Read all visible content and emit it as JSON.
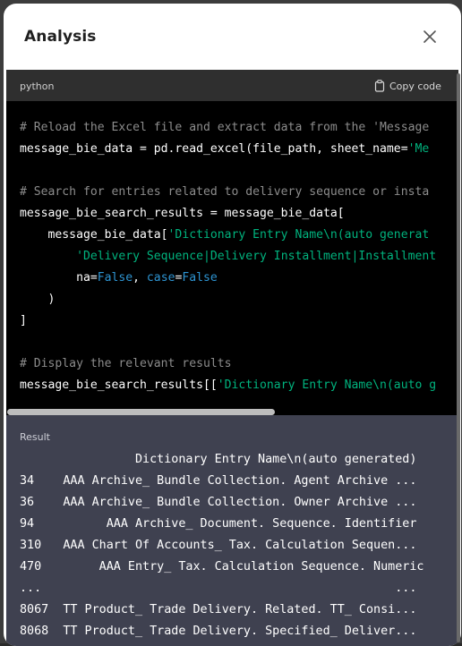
{
  "modal": {
    "title": "Analysis",
    "close_icon": "close-icon"
  },
  "code_block": {
    "language": "python",
    "copy_label": "Copy code",
    "copy_icon": "clipboard-icon",
    "lines": [
      [
        {
          "t": "# Reload the Excel file and extract data from the 'Message",
          "c": "comment"
        }
      ],
      [
        {
          "t": "message_bie_data = pd.read_excel(file_path, sheet_name=",
          "c": ""
        },
        {
          "t": "'Me",
          "c": "str"
        }
      ],
      [],
      [
        {
          "t": "# Search for entries related to delivery sequence or insta",
          "c": "comment"
        }
      ],
      [
        {
          "t": "message_bie_search_results = message_bie_data[",
          "c": ""
        }
      ],
      [
        {
          "t": "    message_bie_data[",
          "c": ""
        },
        {
          "t": "'Dictionary Entry Name\\n(auto generat",
          "c": "str"
        }
      ],
      [
        {
          "t": "        ",
          "c": ""
        },
        {
          "t": "'Delivery Sequence|Delivery Installment|Installment",
          "c": "str"
        }
      ],
      [
        {
          "t": "        na=",
          "c": ""
        },
        {
          "t": "False",
          "c": "kw"
        },
        {
          "t": ", ",
          "c": ""
        },
        {
          "t": "case",
          "c": "kw"
        },
        {
          "t": "=",
          "c": ""
        },
        {
          "t": "False",
          "c": "kw"
        }
      ],
      [
        {
          "t": "    )",
          "c": ""
        }
      ],
      [
        {
          "t": "]",
          "c": ""
        }
      ],
      [],
      [
        {
          "t": "# Display the relevant results",
          "c": "comment"
        }
      ],
      [
        {
          "t": "message_bie_search_results[[",
          "c": ""
        },
        {
          "t": "'Dictionary Entry Name\\n(auto g",
          "c": "str"
        }
      ]
    ]
  },
  "result": {
    "label": "Result",
    "lines": [
      "                Dictionary Entry Name\\n(auto generated)",
      "34    AAA Archive_ Bundle Collection. Agent Archive ...",
      "36    AAA Archive_ Bundle Collection. Owner Archive ...",
      "94          AAA Archive_ Document. Sequence. Identifier",
      "310   AAA Chart Of Accounts_ Tax. Calculation Sequen...",
      "470        AAA Entry_ Tax. Calculation Sequence. Numeric",
      "...                                                 ...",
      "8067  TT Product_ Trade Delivery. Related. TT_ Consi...",
      "8068  TT Product_ Trade Delivery. Specified_ Deliver..."
    ]
  },
  "colors": {
    "comment": "#8c8c8c",
    "string": "#00b37e",
    "keyword": "#2e95d3",
    "result_bg": "#3f4150",
    "code_bg": "#000000",
    "code_header_bg": "#2f2f2f"
  }
}
